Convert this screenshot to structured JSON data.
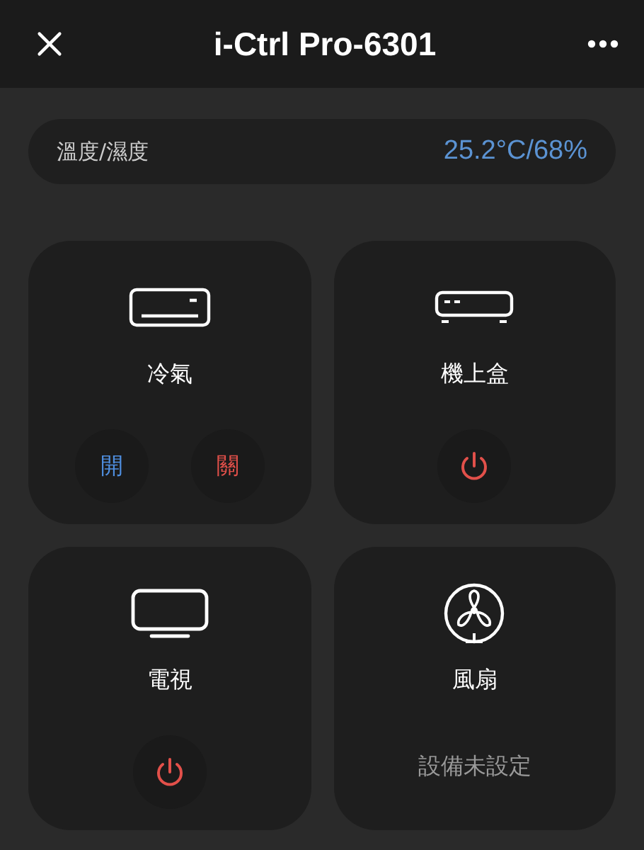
{
  "header": {
    "title": "i-Ctrl Pro-6301"
  },
  "sensor": {
    "label": "溫度/濕度",
    "reading": "25.2°C/68%"
  },
  "devices": [
    {
      "kind": "ac",
      "name": "冷氣",
      "controls": [
        {
          "kind": "text",
          "label": "開",
          "color": "#4f8fe0"
        },
        {
          "kind": "text",
          "label": "關",
          "color": "#e2504a"
        }
      ]
    },
    {
      "kind": "settop",
      "name": "機上盒",
      "controls": [
        {
          "kind": "power"
        }
      ]
    },
    {
      "kind": "tv",
      "name": "電視",
      "controls": [
        {
          "kind": "power"
        }
      ]
    },
    {
      "kind": "fan",
      "name": "風扇",
      "status": "設備未設定"
    }
  ]
}
